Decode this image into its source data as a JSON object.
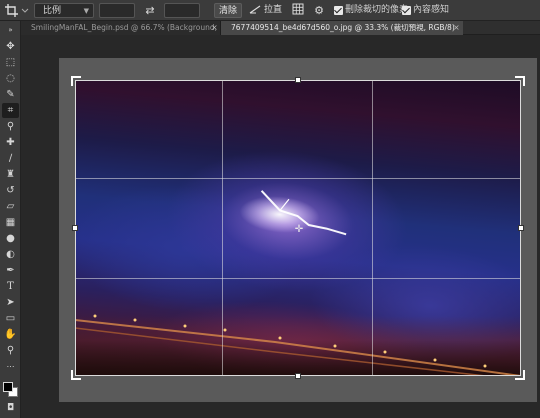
{
  "options_bar": {
    "ratio_value": "比例",
    "clear_label": "清除",
    "straighten_label": "拉直",
    "delete_cropped_label": "刪除裁切的像素",
    "content_aware_label": "內容感知"
  },
  "tabs": [
    {
      "label": "SmilingManFAL_Begin.psd @ 66.7% (Background, RGB/8)"
    },
    {
      "label": "7677409514_be4d67d560_o.jpg @ 33.3% (裁切預視, RGB/8)"
    }
  ],
  "icons": {
    "crop_tool": "crop-icon",
    "swap": "swap-arrows-icon",
    "straighten": "straighten-icon",
    "grid": "grid-overlay-icon",
    "settings": "gear-icon"
  },
  "colors": {
    "foreground": "#000000",
    "background": "#ffffff",
    "ui_panel": "#3b3b3b",
    "workspace": "#282828"
  }
}
